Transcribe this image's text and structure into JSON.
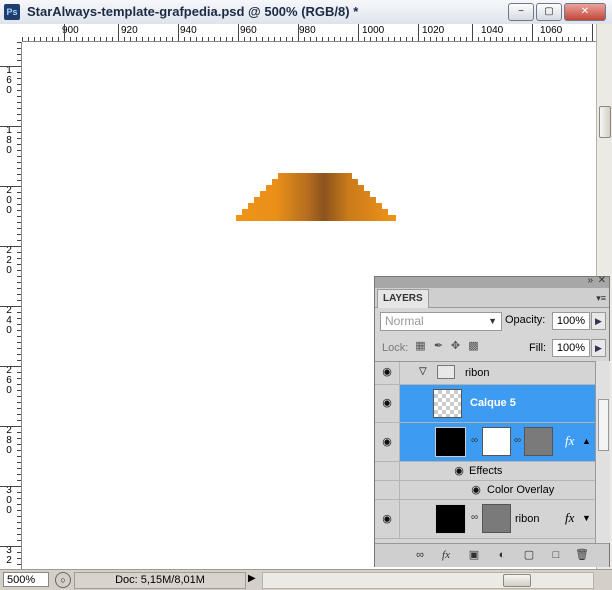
{
  "window": {
    "app_icon": "Ps",
    "title": "StarAlways-template-grafpedia.psd @ 500% (RGB/8) *",
    "buttons": {
      "minimize": "−",
      "restore": "▢",
      "close": "✕"
    }
  },
  "rulers": {
    "horizontal": [
      "900",
      "920",
      "940",
      "960",
      "980",
      "1000",
      "1020",
      "1040",
      "1060"
    ],
    "vertical": [
      "160",
      "180",
      "200",
      "220",
      "240",
      "260",
      "280",
      "300",
      "32"
    ]
  },
  "statusbar": {
    "zoom": "500%",
    "doc_info": "Doc: 5,15M/8,01M",
    "arrow": "▶"
  },
  "layers_panel": {
    "tab_label": "LAYERS",
    "collapse_icon": "»",
    "close_icon": "✕",
    "menu_icon": "▾≡",
    "blend_mode": "Normal",
    "opacity_label": "Opacity:",
    "opacity_value": "100%",
    "lock_label": "Lock:",
    "fill_label": "Fill:",
    "fill_value": "100%",
    "layers": {
      "group_name": "ribon",
      "layer_calque5": "Calque 5",
      "layer_shape_fx": "fx",
      "effects_label": "Effects",
      "effect_color_overlay": "Color Overlay",
      "layer_ribon": "ribon",
      "layer_ribon_fx": "fx"
    },
    "colors": {
      "selection": "#3d9cf2",
      "canvas_shape": "#e8931c"
    }
  }
}
